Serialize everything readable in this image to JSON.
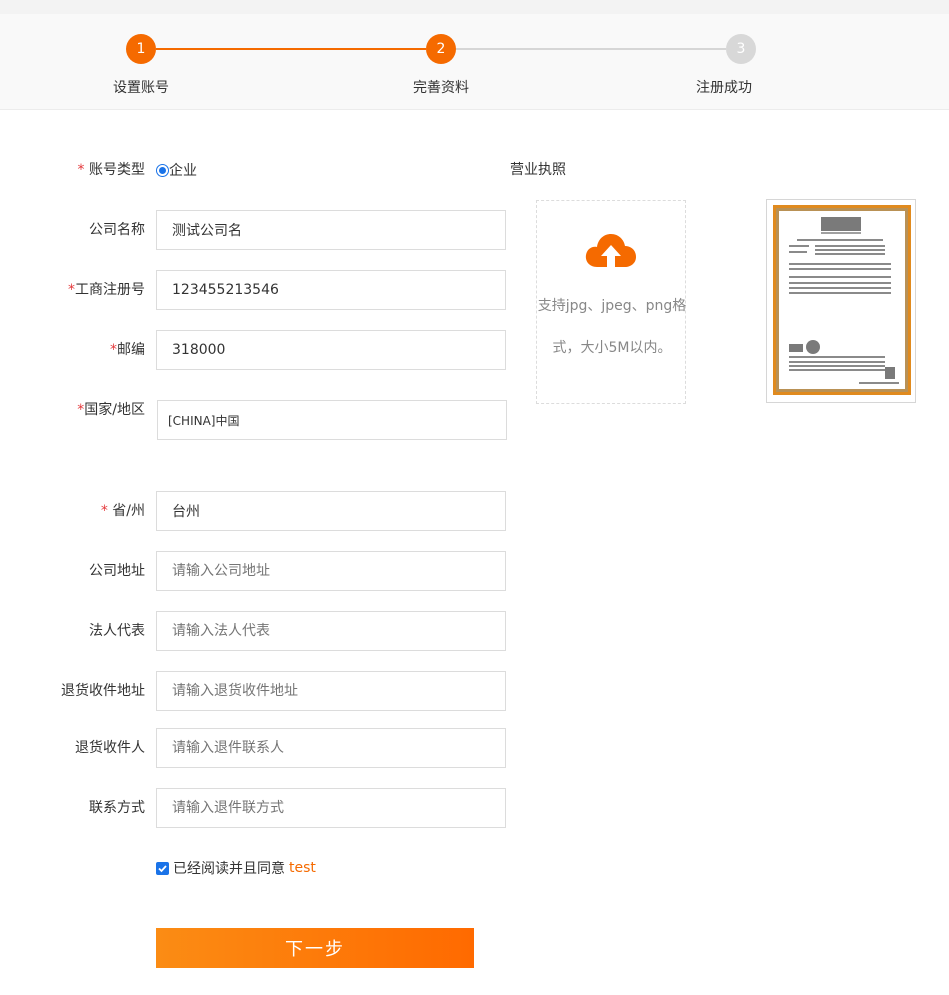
{
  "steps": [
    {
      "number": "1",
      "label": "设置账号",
      "status": "done"
    },
    {
      "number": "2",
      "label": "完善资料",
      "status": "current"
    },
    {
      "number": "3",
      "label": "注册成功",
      "status": "todo"
    }
  ],
  "form": {
    "account_type": {
      "required_mark": "* ",
      "label": "账号类型",
      "option": "企业"
    },
    "company_name": {
      "label": "公司名称",
      "value": "测试公司名"
    },
    "reg_no": {
      "required_mark": "*",
      "label": "工商注册号",
      "value": "123455213546"
    },
    "postcode": {
      "required_mark": "*",
      "label": "邮编",
      "value": "318000"
    },
    "country": {
      "required_mark": "*",
      "label": "国家/地区",
      "value": "[CHINA]中国"
    },
    "province": {
      "required_mark": "* ",
      "label": "省/州",
      "value": "台州"
    },
    "address": {
      "label": "公司地址",
      "placeholder": "请输入公司地址"
    },
    "legal_rep": {
      "label": "法人代表",
      "placeholder": "请输入法人代表"
    },
    "return_address": {
      "label": "退货收件地址",
      "placeholder": "请输入退货收件地址"
    },
    "return_receiver": {
      "label": "退货收件人",
      "placeholder": "请输入退件联系人"
    },
    "contact": {
      "label": "联系方式",
      "placeholder": "请输入退件联方式"
    }
  },
  "license": {
    "label": "营业执照",
    "upload_hint_1": "支持jpg、jpeg、png格",
    "upload_hint_2": "式，大小5M以内。",
    "icon": "cloud-upload-icon"
  },
  "agreement": {
    "text": "已经阅读并且同意",
    "link": "test",
    "checked": true
  },
  "next_button": "下一步",
  "colors": {
    "accent": "#f56a00",
    "required": "#e4393c",
    "check": "#1a73e8"
  }
}
